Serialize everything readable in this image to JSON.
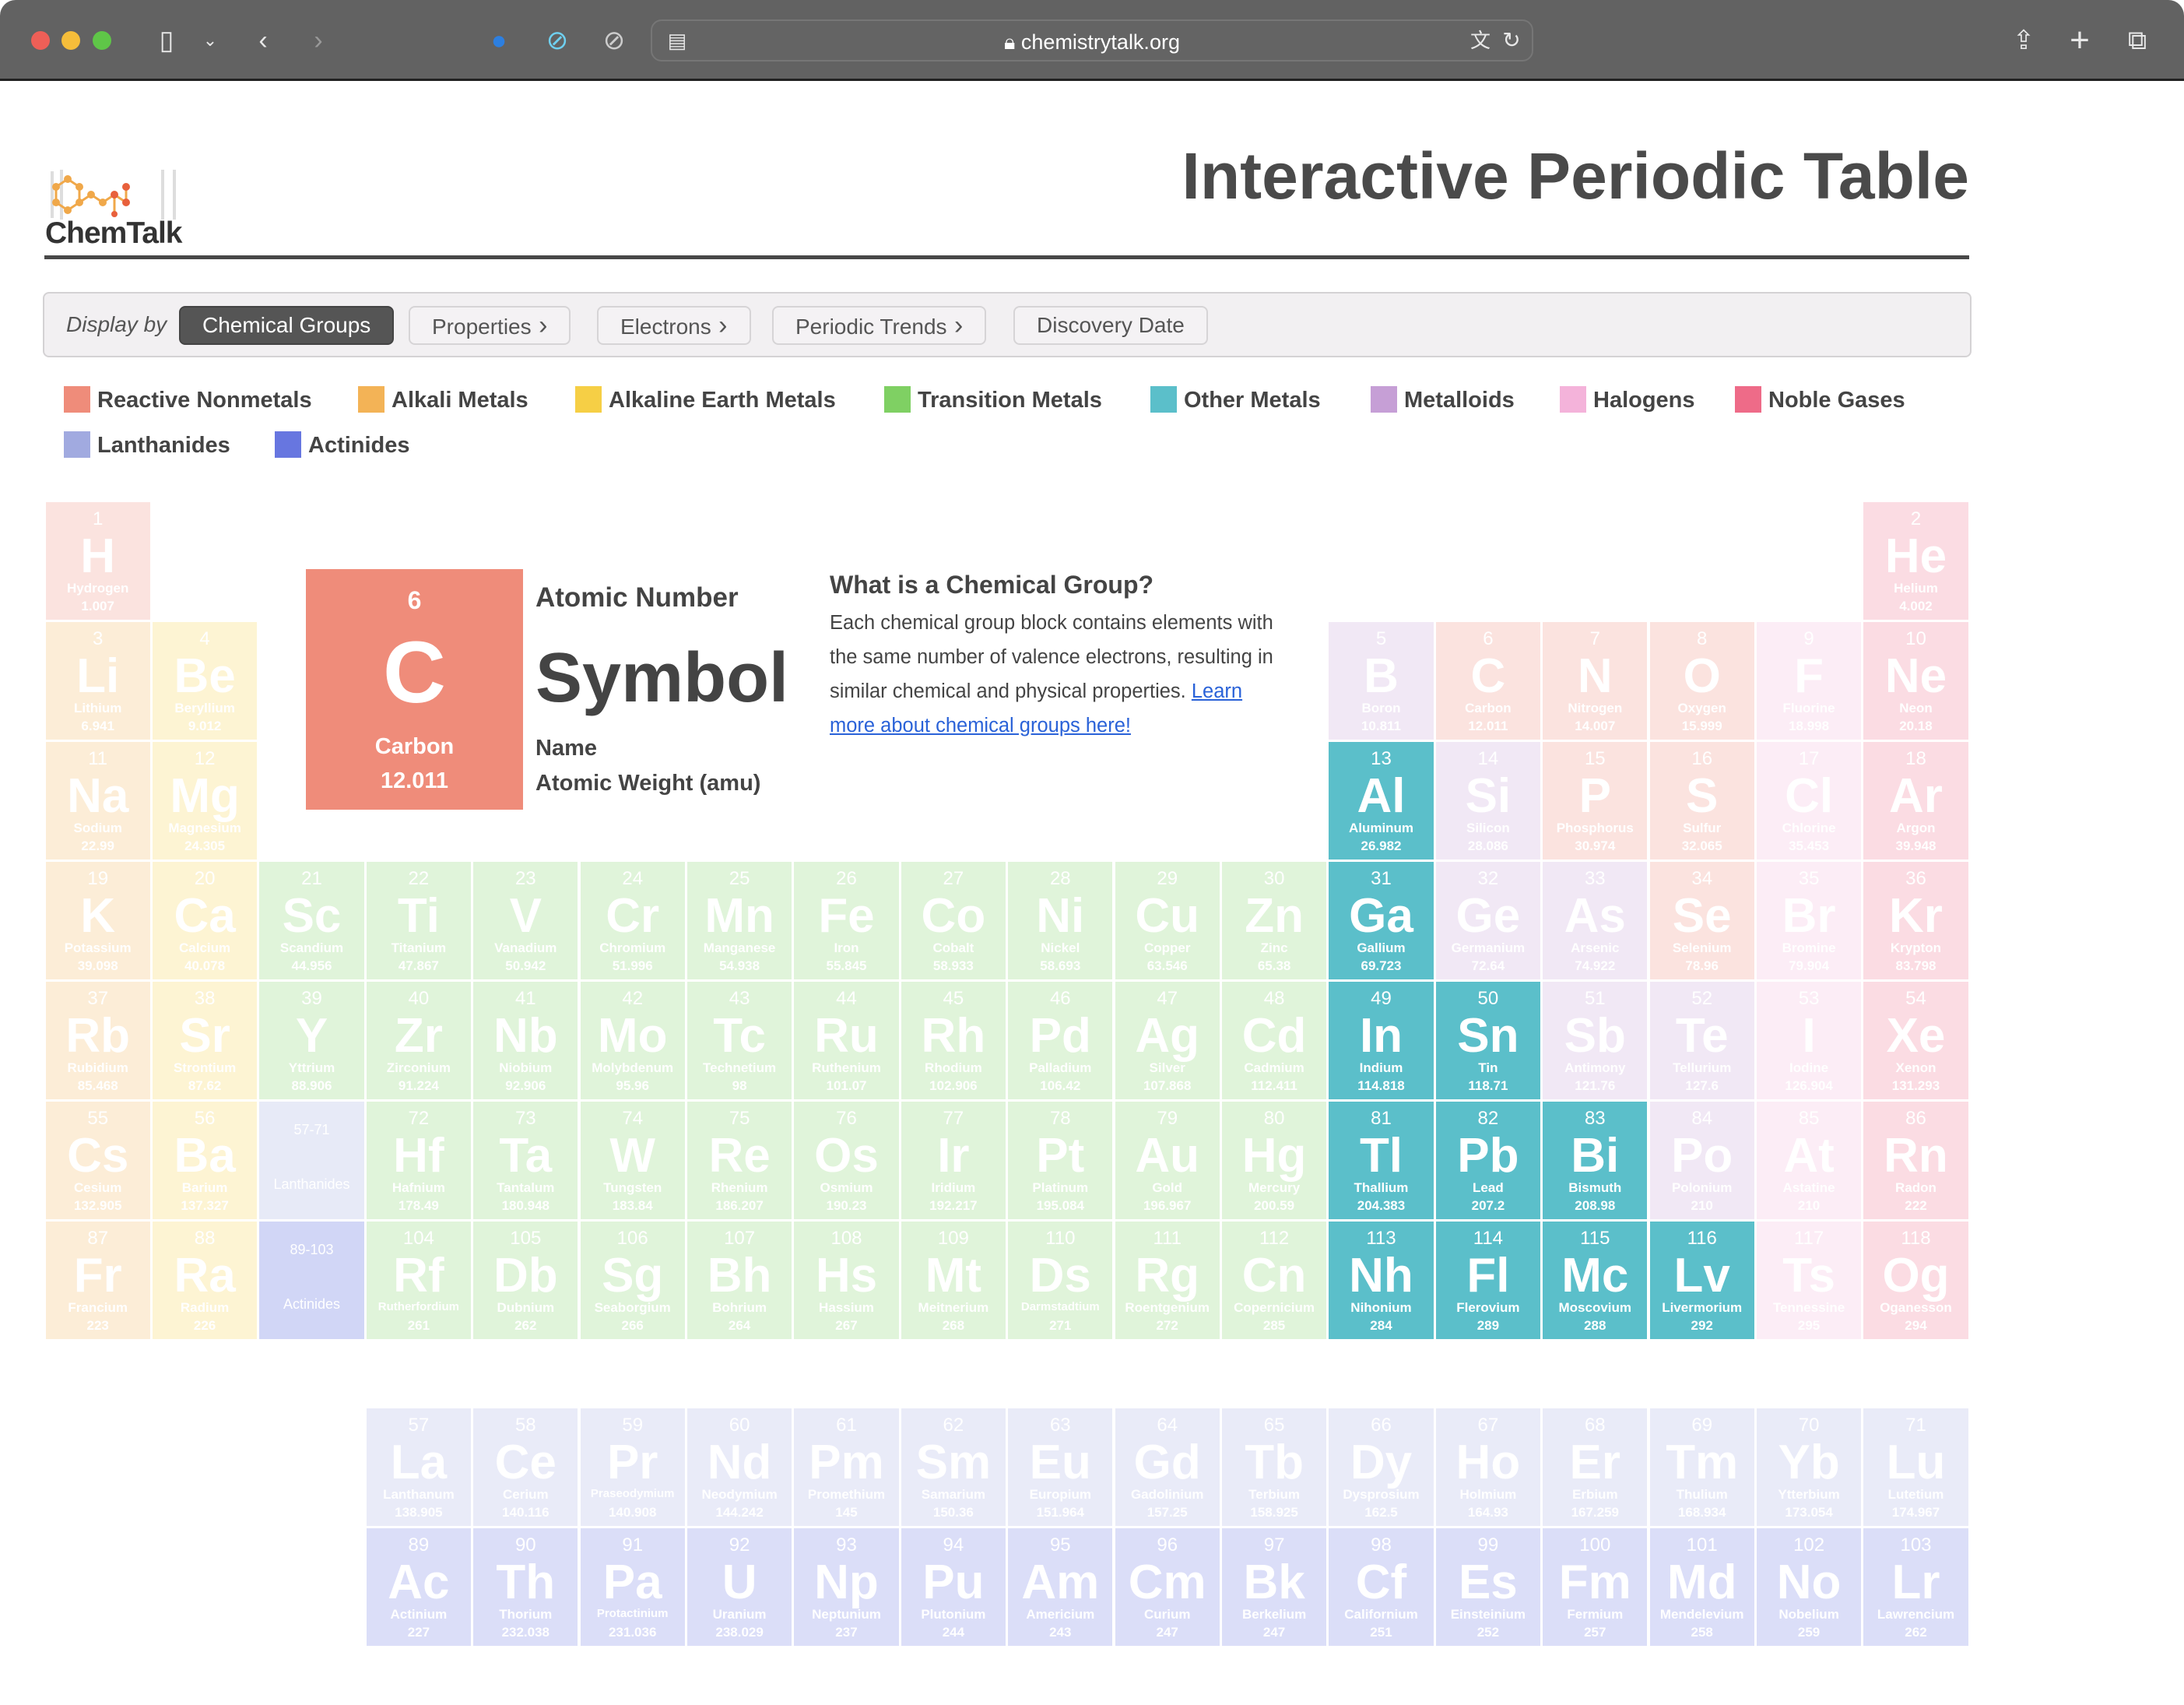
{
  "browser": {
    "url": "chemistrytalk.org"
  },
  "header": {
    "logo_text": "ChemTalk",
    "title": "Interactive Periodic Table"
  },
  "display_bar": {
    "label": "Display by",
    "buttons": [
      {
        "label": "Chemical Groups",
        "active": true,
        "chevron": false
      },
      {
        "label": "Properties",
        "active": false,
        "chevron": true
      },
      {
        "label": "Electrons",
        "active": false,
        "chevron": true
      },
      {
        "label": "Periodic Trends",
        "active": false,
        "chevron": true
      },
      {
        "label": "Discovery Date",
        "active": false,
        "chevron": false
      }
    ]
  },
  "legend": [
    {
      "key": "rn",
      "label": "Reactive Nonmetals",
      "color": "#ef8c7a"
    },
    {
      "key": "am",
      "label": "Alkali Metals",
      "color": "#f3b356"
    },
    {
      "key": "ae",
      "label": "Alkaline Earth Metals",
      "color": "#f6cf45"
    },
    {
      "key": "tm",
      "label": "Transition Metals",
      "color": "#7fd063"
    },
    {
      "key": "om",
      "label": "Other Metals",
      "color": "#5bbfca"
    },
    {
      "key": "md",
      "label": "Metalloids",
      "color": "#c69fd6"
    },
    {
      "key": "ha",
      "label": "Halogens",
      "color": "#f4b3da"
    },
    {
      "key": "ng",
      "label": "Noble Gases",
      "color": "#ee6b88"
    },
    {
      "key": "la",
      "label": "Lanthanides",
      "color": "#a1aae0"
    },
    {
      "key": "ac",
      "label": "Actinides",
      "color": "#6776e0"
    }
  ],
  "highlighted_group": "om",
  "key_card": {
    "number": "6",
    "symbol": "C",
    "name": "Carbon",
    "weight": "12.011",
    "labels": {
      "number": "Atomic Number",
      "symbol": "Symbol",
      "name": "Name",
      "weight": "Atomic Weight (amu)"
    }
  },
  "info": {
    "heading": "What is a Chemical Group?",
    "text": "Each chemical group block contains elements with the same number of valence electrons, resulting in similar chemical and physical properties. ",
    "link": "Learn more about chemical groups here!"
  },
  "placeholders": [
    {
      "range": "57-71",
      "label": "Lanthanides",
      "group": "la"
    },
    {
      "range": "89-103",
      "label": "Actinides",
      "group": "ac"
    }
  ],
  "elements": [
    [
      "1",
      "H",
      "Hydrogen",
      "1.007",
      "rn"
    ],
    [
      "2",
      "He",
      "Helium",
      "4.002",
      "ng"
    ],
    [
      "3",
      "Li",
      "Lithium",
      "6.941",
      "am"
    ],
    [
      "4",
      "Be",
      "Beryllium",
      "9.012",
      "ae"
    ],
    [
      "5",
      "B",
      "Boron",
      "10.811",
      "md"
    ],
    [
      "6",
      "C",
      "Carbon",
      "12.011",
      "rn"
    ],
    [
      "7",
      "N",
      "Nitrogen",
      "14.007",
      "rn"
    ],
    [
      "8",
      "O",
      "Oxygen",
      "15.999",
      "rn"
    ],
    [
      "9",
      "F",
      "Fluorine",
      "18.998",
      "ha"
    ],
    [
      "10",
      "Ne",
      "Neon",
      "20.18",
      "ng"
    ],
    [
      "11",
      "Na",
      "Sodium",
      "22.99",
      "am"
    ],
    [
      "12",
      "Mg",
      "Magnesium",
      "24.305",
      "ae"
    ],
    [
      "13",
      "Al",
      "Aluminum",
      "26.982",
      "om"
    ],
    [
      "14",
      "Si",
      "Silicon",
      "28.086",
      "md"
    ],
    [
      "15",
      "P",
      "Phosphorus",
      "30.974",
      "rn"
    ],
    [
      "16",
      "S",
      "Sulfur",
      "32.065",
      "rn"
    ],
    [
      "17",
      "Cl",
      "Chlorine",
      "35.453",
      "ha"
    ],
    [
      "18",
      "Ar",
      "Argon",
      "39.948",
      "ng"
    ],
    [
      "19",
      "K",
      "Potassium",
      "39.098",
      "am"
    ],
    [
      "20",
      "Ca",
      "Calcium",
      "40.078",
      "ae"
    ],
    [
      "21",
      "Sc",
      "Scandium",
      "44.956",
      "tm"
    ],
    [
      "22",
      "Ti",
      "Titanium",
      "47.867",
      "tm"
    ],
    [
      "23",
      "V",
      "Vanadium",
      "50.942",
      "tm"
    ],
    [
      "24",
      "Cr",
      "Chromium",
      "51.996",
      "tm"
    ],
    [
      "25",
      "Mn",
      "Manganese",
      "54.938",
      "tm"
    ],
    [
      "26",
      "Fe",
      "Iron",
      "55.845",
      "tm"
    ],
    [
      "27",
      "Co",
      "Cobalt",
      "58.933",
      "tm"
    ],
    [
      "28",
      "Ni",
      "Nickel",
      "58.693",
      "tm"
    ],
    [
      "29",
      "Cu",
      "Copper",
      "63.546",
      "tm"
    ],
    [
      "30",
      "Zn",
      "Zinc",
      "65.38",
      "tm"
    ],
    [
      "31",
      "Ga",
      "Gallium",
      "69.723",
      "om"
    ],
    [
      "32",
      "Ge",
      "Germanium",
      "72.64",
      "md"
    ],
    [
      "33",
      "As",
      "Arsenic",
      "74.922",
      "md"
    ],
    [
      "34",
      "Se",
      "Selenium",
      "78.96",
      "rn"
    ],
    [
      "35",
      "Br",
      "Bromine",
      "79.904",
      "ha"
    ],
    [
      "36",
      "Kr",
      "Krypton",
      "83.798",
      "ng"
    ],
    [
      "37",
      "Rb",
      "Rubidium",
      "85.468",
      "am"
    ],
    [
      "38",
      "Sr",
      "Strontium",
      "87.62",
      "ae"
    ],
    [
      "39",
      "Y",
      "Yttrium",
      "88.906",
      "tm"
    ],
    [
      "40",
      "Zr",
      "Zirconium",
      "91.224",
      "tm"
    ],
    [
      "41",
      "Nb",
      "Niobium",
      "92.906",
      "tm"
    ],
    [
      "42",
      "Mo",
      "Molybdenum",
      "95.96",
      "tm"
    ],
    [
      "43",
      "Tc",
      "Technetium",
      "98",
      "tm"
    ],
    [
      "44",
      "Ru",
      "Ruthenium",
      "101.07",
      "tm"
    ],
    [
      "45",
      "Rh",
      "Rhodium",
      "102.906",
      "tm"
    ],
    [
      "46",
      "Pd",
      "Palladium",
      "106.42",
      "tm"
    ],
    [
      "47",
      "Ag",
      "Silver",
      "107.868",
      "tm"
    ],
    [
      "48",
      "Cd",
      "Cadmium",
      "112.411",
      "tm"
    ],
    [
      "49",
      "In",
      "Indium",
      "114.818",
      "om"
    ],
    [
      "50",
      "Sn",
      "Tin",
      "118.71",
      "om"
    ],
    [
      "51",
      "Sb",
      "Antimony",
      "121.76",
      "md"
    ],
    [
      "52",
      "Te",
      "Tellurium",
      "127.6",
      "md"
    ],
    [
      "53",
      "I",
      "Iodine",
      "126.904",
      "ha"
    ],
    [
      "54",
      "Xe",
      "Xenon",
      "131.293",
      "ng"
    ],
    [
      "55",
      "Cs",
      "Cesium",
      "132.905",
      "am"
    ],
    [
      "56",
      "Ba",
      "Barium",
      "137.327",
      "ae"
    ],
    [
      "57",
      "La",
      "Lanthanum",
      "138.905",
      "la"
    ],
    [
      "58",
      "Ce",
      "Cerium",
      "140.116",
      "la"
    ],
    [
      "59",
      "Pr",
      "Praseodymium",
      "140.908",
      "la"
    ],
    [
      "60",
      "Nd",
      "Neodymium",
      "144.242",
      "la"
    ],
    [
      "61",
      "Pm",
      "Promethium",
      "145",
      "la"
    ],
    [
      "62",
      "Sm",
      "Samarium",
      "150.36",
      "la"
    ],
    [
      "63",
      "Eu",
      "Europium",
      "151.964",
      "la"
    ],
    [
      "64",
      "Gd",
      "Gadolinium",
      "157.25",
      "la"
    ],
    [
      "65",
      "Tb",
      "Terbium",
      "158.925",
      "la"
    ],
    [
      "66",
      "Dy",
      "Dysprosium",
      "162.5",
      "la"
    ],
    [
      "67",
      "Ho",
      "Holmium",
      "164.93",
      "la"
    ],
    [
      "68",
      "Er",
      "Erbium",
      "167.259",
      "la"
    ],
    [
      "69",
      "Tm",
      "Thulium",
      "168.934",
      "la"
    ],
    [
      "70",
      "Yb",
      "Ytterbium",
      "173.054",
      "la"
    ],
    [
      "71",
      "Lu",
      "Lutetium",
      "174.967",
      "la"
    ],
    [
      "72",
      "Hf",
      "Hafnium",
      "178.49",
      "tm"
    ],
    [
      "73",
      "Ta",
      "Tantalum",
      "180.948",
      "tm"
    ],
    [
      "74",
      "W",
      "Tungsten",
      "183.84",
      "tm"
    ],
    [
      "75",
      "Re",
      "Rhenium",
      "186.207",
      "tm"
    ],
    [
      "76",
      "Os",
      "Osmium",
      "190.23",
      "tm"
    ],
    [
      "77",
      "Ir",
      "Iridium",
      "192.217",
      "tm"
    ],
    [
      "78",
      "Pt",
      "Platinum",
      "195.084",
      "tm"
    ],
    [
      "79",
      "Au",
      "Gold",
      "196.967",
      "tm"
    ],
    [
      "80",
      "Hg",
      "Mercury",
      "200.59",
      "tm"
    ],
    [
      "81",
      "Tl",
      "Thallium",
      "204.383",
      "om"
    ],
    [
      "82",
      "Pb",
      "Lead",
      "207.2",
      "om"
    ],
    [
      "83",
      "Bi",
      "Bismuth",
      "208.98",
      "om"
    ],
    [
      "84",
      "Po",
      "Polonium",
      "210",
      "md"
    ],
    [
      "85",
      "At",
      "Astatine",
      "210",
      "ha"
    ],
    [
      "86",
      "Rn",
      "Radon",
      "222",
      "ng"
    ],
    [
      "87",
      "Fr",
      "Francium",
      "223",
      "am"
    ],
    [
      "88",
      "Ra",
      "Radium",
      "226",
      "ae"
    ],
    [
      "89",
      "Ac",
      "Actinium",
      "227",
      "ac"
    ],
    [
      "90",
      "Th",
      "Thorium",
      "232.038",
      "ac"
    ],
    [
      "91",
      "Pa",
      "Protactinium",
      "231.036",
      "ac"
    ],
    [
      "92",
      "U",
      "Uranium",
      "238.029",
      "ac"
    ],
    [
      "93",
      "Np",
      "Neptunium",
      "237",
      "ac"
    ],
    [
      "94",
      "Pu",
      "Plutonium",
      "244",
      "ac"
    ],
    [
      "95",
      "Am",
      "Americium",
      "243",
      "ac"
    ],
    [
      "96",
      "Cm",
      "Curium",
      "247",
      "ac"
    ],
    [
      "97",
      "Bk",
      "Berkelium",
      "247",
      "ac"
    ],
    [
      "98",
      "Cf",
      "Californium",
      "251",
      "ac"
    ],
    [
      "99",
      "Es",
      "Einsteinium",
      "252",
      "ac"
    ],
    [
      "100",
      "Fm",
      "Fermium",
      "257",
      "ac"
    ],
    [
      "101",
      "Md",
      "Mendelevium",
      "258",
      "ac"
    ],
    [
      "102",
      "No",
      "Nobelium",
      "259",
      "ac"
    ],
    [
      "103",
      "Lr",
      "Lawrencium",
      "262",
      "ac"
    ],
    [
      "104",
      "Rf",
      "Rutherfordium",
      "261",
      "tm"
    ],
    [
      "105",
      "Db",
      "Dubnium",
      "262",
      "tm"
    ],
    [
      "106",
      "Sg",
      "Seaborgium",
      "266",
      "tm"
    ],
    [
      "107",
      "Bh",
      "Bohrium",
      "264",
      "tm"
    ],
    [
      "108",
      "Hs",
      "Hassium",
      "267",
      "tm"
    ],
    [
      "109",
      "Mt",
      "Meitnerium",
      "268",
      "tm"
    ],
    [
      "110",
      "Ds",
      "Darmstadtium",
      "271",
      "tm"
    ],
    [
      "111",
      "Rg",
      "Roentgenium",
      "272",
      "tm"
    ],
    [
      "112",
      "Cn",
      "Copernicium",
      "285",
      "tm"
    ],
    [
      "113",
      "Nh",
      "Nihonium",
      "284",
      "om"
    ],
    [
      "114",
      "Fl",
      "Flerovium",
      "289",
      "om"
    ],
    [
      "115",
      "Mc",
      "Moscovium",
      "288",
      "om"
    ],
    [
      "116",
      "Lv",
      "Livermorium",
      "292",
      "om"
    ],
    [
      "117",
      "Ts",
      "Tennessine",
      "295",
      "ha"
    ],
    [
      "118",
      "Og",
      "Oganesson",
      "294",
      "ng"
    ]
  ]
}
